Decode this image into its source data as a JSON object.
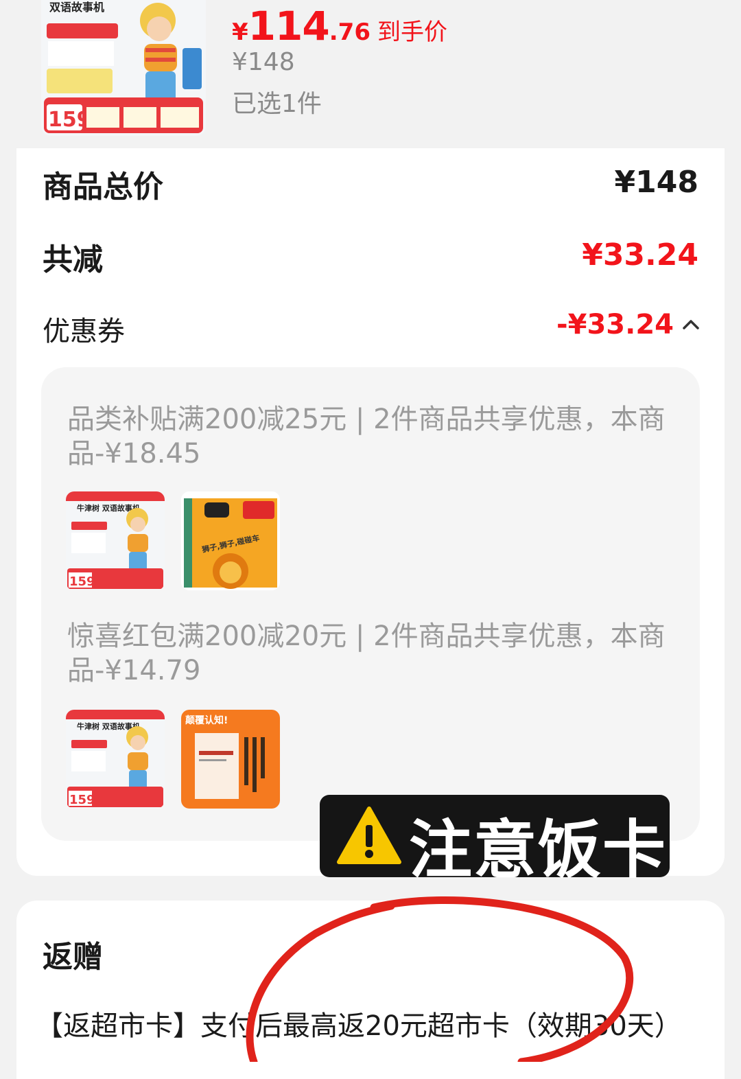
{
  "product": {
    "thumb_title": "双语故事机",
    "thumb_price": "159",
    "price_yen": "¥",
    "price_int": "114",
    "price_dec": ".76",
    "price_label": "到手价",
    "original_price": "¥148",
    "selected": "已选1件"
  },
  "summary": {
    "total_label": "商品总价",
    "total_value": "¥148",
    "discount_label": "共减",
    "discount_value": "¥33.24",
    "coupon_label": "优惠券",
    "coupon_value": "-¥33.24"
  },
  "coupons": [
    {
      "text": "品类补贴满200减25元 | 2件商品共享优惠，本商品-¥18.45",
      "item_titles": [
        "牛津树 双语故事机",
        "狮子,狮子,碰碰车"
      ],
      "item_price": "159"
    },
    {
      "text": "惊喜红包满200减20元 | 2件商品共享优惠，本商品-¥14.79",
      "item_titles": [
        "牛津树 双语故事机",
        "颠覆认知!"
      ],
      "item_price": "159"
    }
  ],
  "sticker": {
    "text": "注意饭卡"
  },
  "rebate": {
    "title": "返赠",
    "text": "【返超市卡】支付后最高返20元超市卡（效期30天）"
  },
  "colors": {
    "accent_red": "#f2141b",
    "annotation_red": "#e0231b"
  }
}
